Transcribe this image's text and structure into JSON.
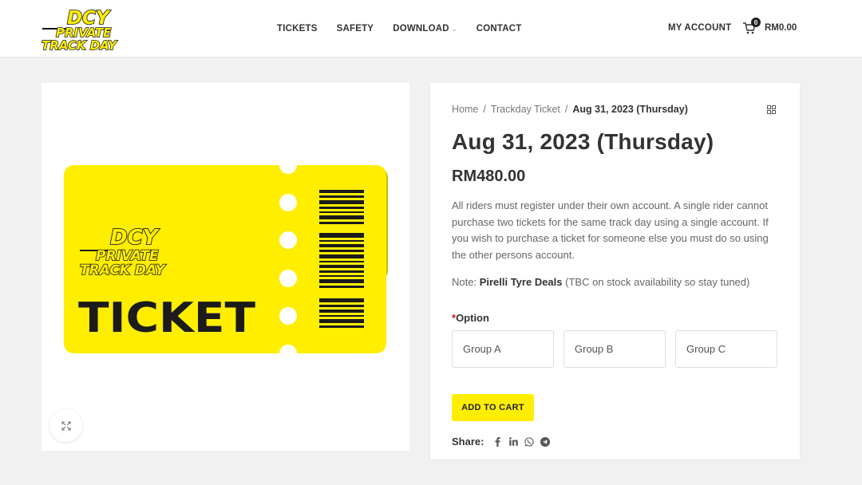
{
  "header": {
    "logo": {
      "line1": "DCY",
      "line2": "PRIVATE",
      "line3": "TRACK DAY"
    },
    "nav": [
      {
        "label": "TICKETS"
      },
      {
        "label": "SAFETY"
      },
      {
        "label": "DOWNLOAD"
      },
      {
        "label": "CONTACT"
      }
    ],
    "account_label": "MY ACCOUNT",
    "cart": {
      "count": "0",
      "total": "RM0.00"
    }
  },
  "product_image": {
    "ticket_text": "TICKET",
    "logo": {
      "line1": "DCY",
      "line2": "PRIVATE",
      "line3": "TRACK DAY"
    },
    "colors": {
      "ticket": "#ffee00",
      "ticket_shadow": "#c9bb00",
      "ink": "#1b1b1b"
    },
    "zoom_icon": "expand-icon"
  },
  "summary": {
    "breadcrumb": {
      "home": "Home",
      "category": "Trackday Ticket",
      "current": "Aug 31, 2023 (Thursday)"
    },
    "title": "Aug 31, 2023 (Thursday)",
    "price": "RM480.00",
    "description": "All riders must register under their own account. A single rider cannot purchase two tickets for the same track day using a single account. If you wish to purchase a ticket for someone else you must do so using the other persons account.",
    "note": {
      "prefix": "Note: ",
      "highlight": "Pirelli Tyre Deals",
      "suffix": " (TBC on stock availability so stay tuned)"
    },
    "option": {
      "required_mark": "*",
      "label": "Option",
      "choices": [
        "Group A",
        "Group B",
        "Group C"
      ]
    },
    "add_to_cart": "ADD TO CART",
    "share": {
      "label": "Share:",
      "icons": [
        "facebook-icon",
        "linkedin-icon",
        "whatsapp-icon",
        "telegram-icon"
      ]
    }
  },
  "colors": {
    "accent": "#ffee00",
    "required": "#e01020"
  }
}
